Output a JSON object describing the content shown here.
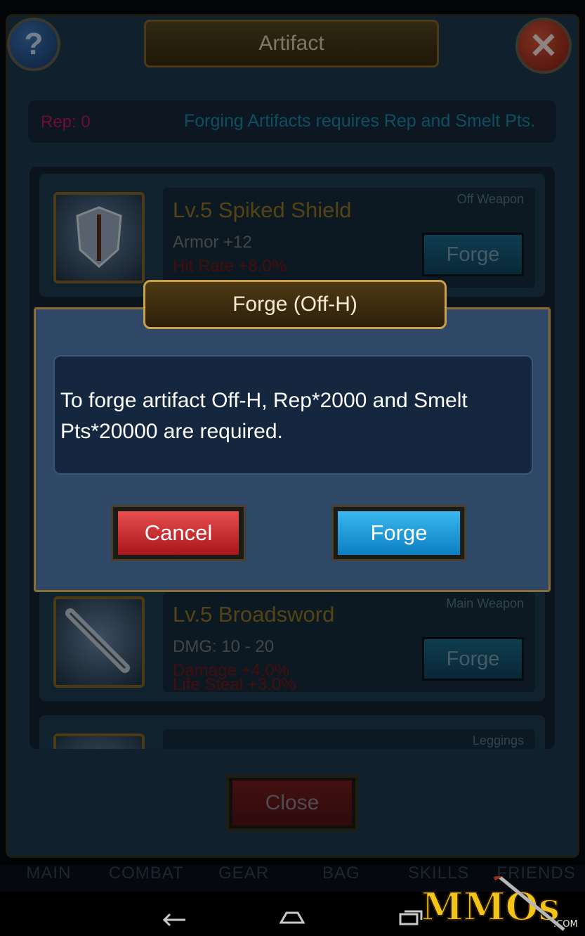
{
  "window": {
    "title": "Artifact",
    "help_glyph": "?",
    "close_glyph": "✕"
  },
  "rep_bar": {
    "rep_label": "Rep: 0",
    "info": "Forging Artifacts requires Rep and Smelt Pts."
  },
  "items": [
    {
      "name": "Lv.5 Spiked Shield",
      "stat": "Armor +12",
      "bonus1": "Hit Rate +8.0%",
      "bonus2": "",
      "slot": "Off Weapon",
      "button": "Forge",
      "icon": "shield-icon"
    },
    {
      "name": "Lv.5 Broadsword",
      "stat": "DMG: 10 - 20",
      "bonus1": "Damage +4.0%",
      "bonus2": "Life Steal +3.0%",
      "slot": "Main Weapon",
      "button": "Forge",
      "icon": "sword-icon"
    },
    {
      "name": "",
      "stat": "",
      "bonus1": "",
      "bonus2": "",
      "slot": "Leggings",
      "button": "",
      "icon": "leggings-icon"
    }
  ],
  "close_button": "Close",
  "tabs": [
    "MAIN",
    "COMBAT",
    "GEAR",
    "BAG",
    "SKILLS",
    "FRIENDS"
  ],
  "dialog": {
    "title": "Forge (Off-H)",
    "message": "To forge artifact Off-H, Rep*2000 and Smelt Pts*20000 are required.",
    "cancel": "Cancel",
    "confirm": "Forge"
  },
  "navbar": {
    "back": "back-icon",
    "home": "home-icon",
    "recents": "recents-icon"
  },
  "watermark": {
    "text": "MMOs",
    "suffix": ".COM"
  },
  "colors": {
    "rep": "#c8175e",
    "info": "#1a8fb3",
    "item_name": "#9a7a24",
    "cancel": "#d2383d",
    "forge": "#1e9ad8"
  }
}
